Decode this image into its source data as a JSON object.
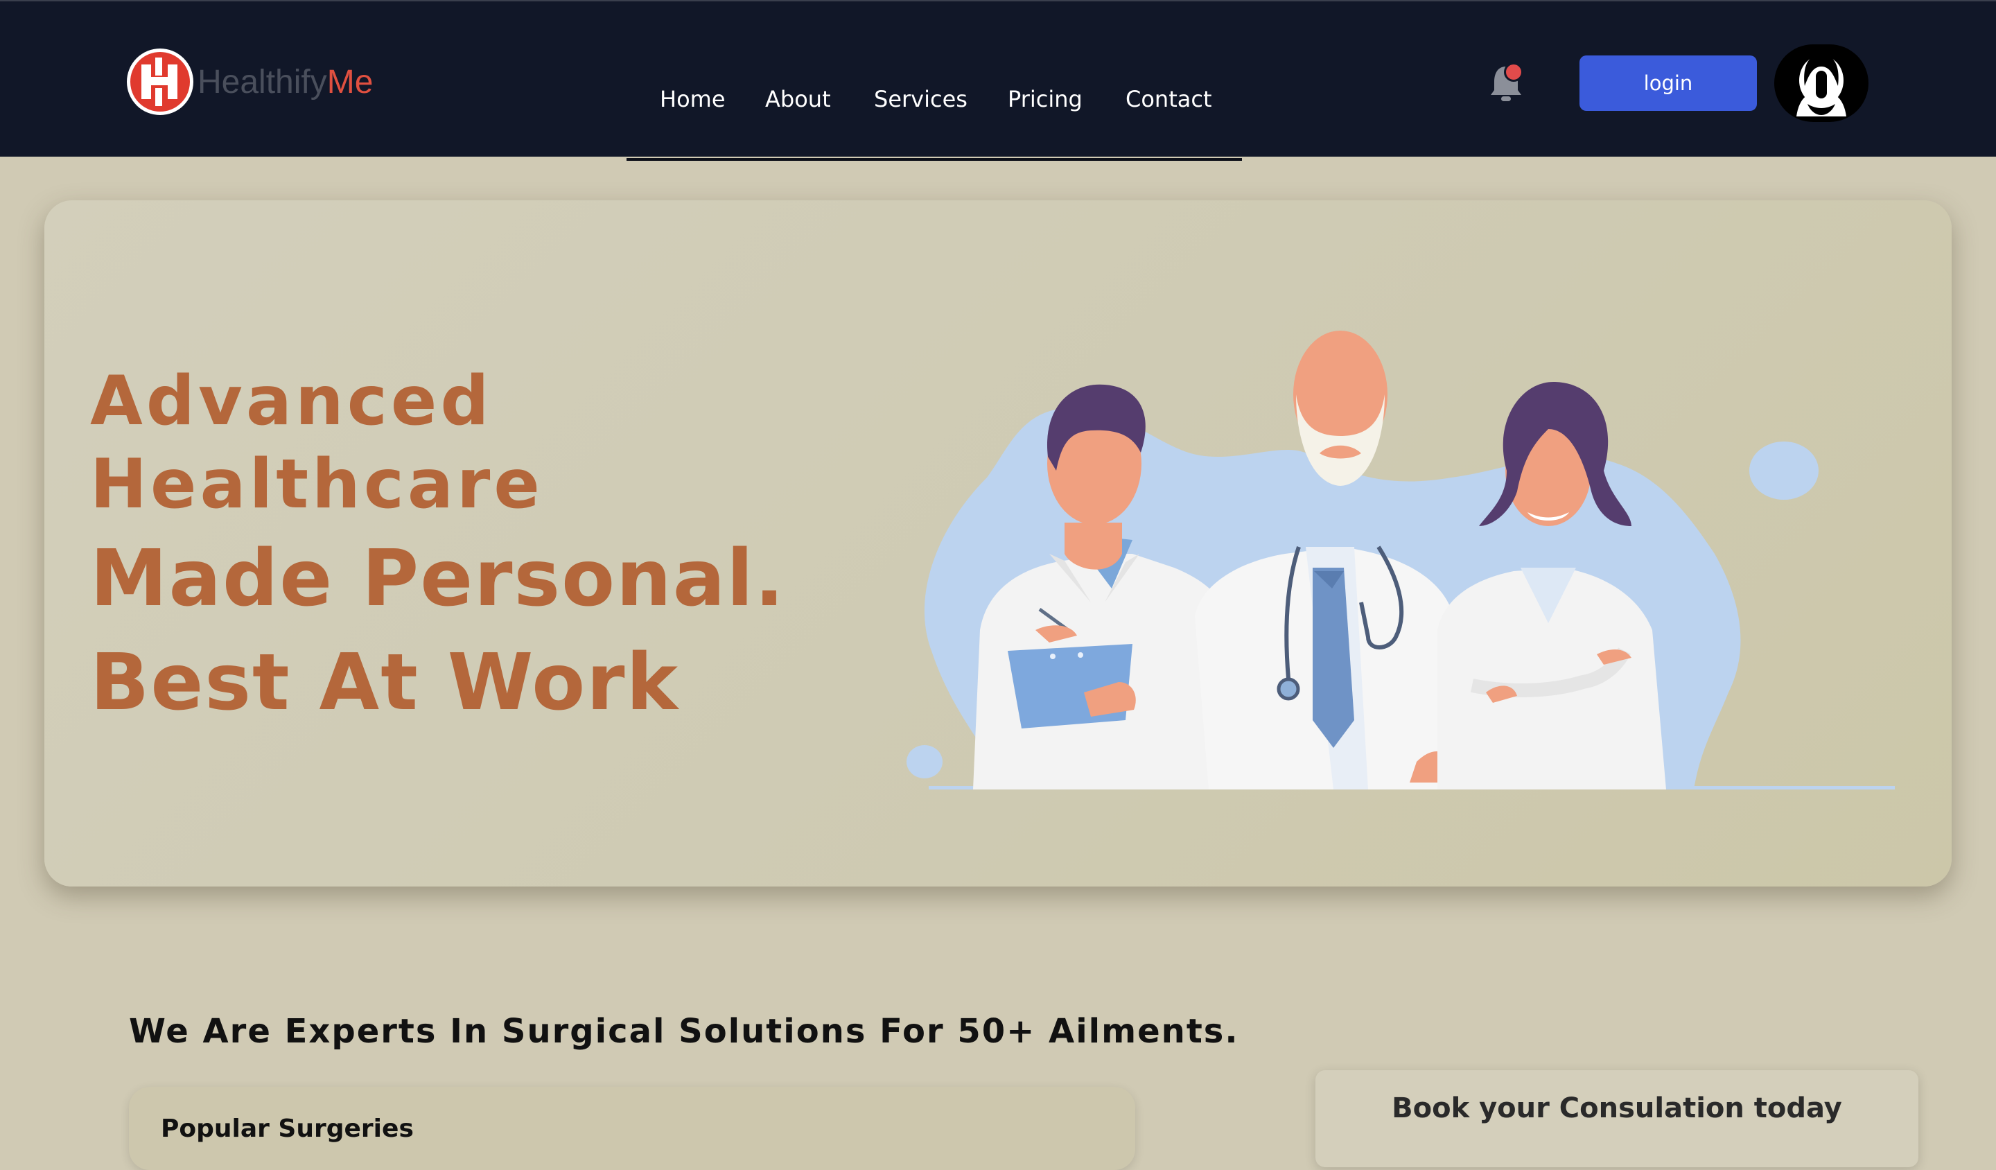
{
  "brand": {
    "name_part1": "Healthify",
    "name_part2": "Me"
  },
  "nav": {
    "items": [
      {
        "label": "Home"
      },
      {
        "label": "About"
      },
      {
        "label": "Services"
      },
      {
        "label": "Pricing"
      },
      {
        "label": "Contact"
      }
    ],
    "login_label": "login"
  },
  "hero": {
    "line1": "Advanced",
    "line2": "Healthcare",
    "line3": "Made Personal.",
    "line4": "Best At Work"
  },
  "experts_heading": "We Are Experts In Surgical Solutions For 50+ Ailments.",
  "surgeries": {
    "title": "Popular Surgeries"
  },
  "consultation": {
    "title": "Book your Consulation today"
  },
  "colors": {
    "navbar_bg": "#111728",
    "page_bg": "#d0cab4",
    "hero_text": "#b4673b",
    "login_button": "#3b5bdb",
    "brand_red": "#e05040"
  },
  "icons": {
    "logo": "healthifyme-logo-icon",
    "notification": "bell-icon",
    "avatar": "user-avatar-icon"
  }
}
